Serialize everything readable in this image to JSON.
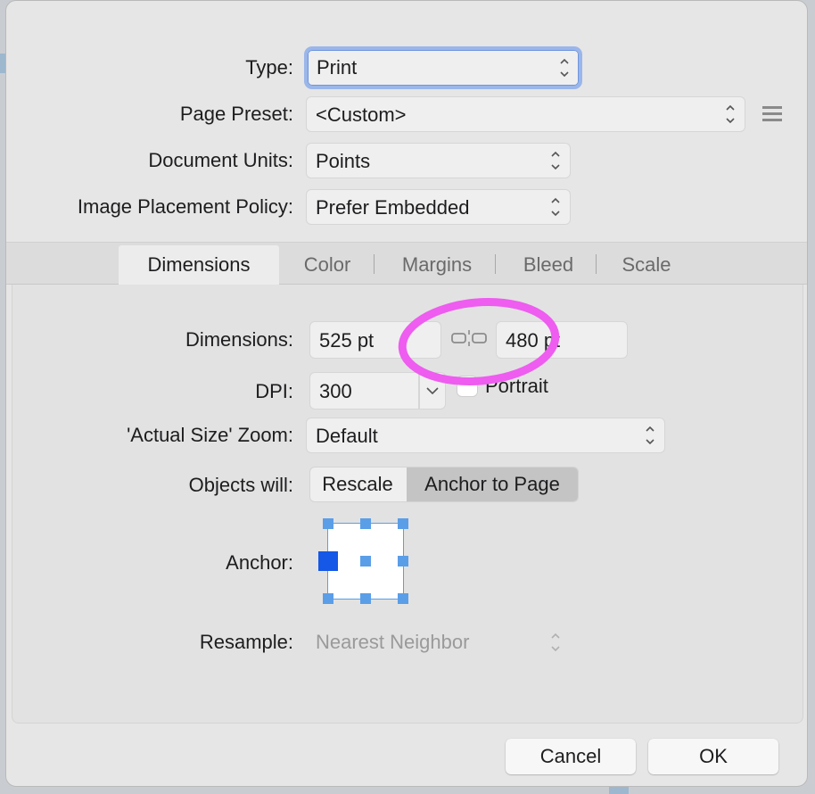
{
  "general": {
    "type_label": "Type:",
    "type_value": "Print",
    "page_preset_label": "Page Preset:",
    "page_preset_value": "<Custom>",
    "document_units_label": "Document Units:",
    "document_units_value": "Points",
    "image_policy_label": "Image Placement Policy:",
    "image_policy_value": "Prefer Embedded"
  },
  "tabs": [
    {
      "label": "Dimensions",
      "active": true
    },
    {
      "label": "Color",
      "active": false
    },
    {
      "label": "Margins",
      "active": false
    },
    {
      "label": "Bleed",
      "active": false
    },
    {
      "label": "Scale",
      "active": false
    }
  ],
  "dimensions": {
    "dimensions_label": "Dimensions:",
    "width_value": "525 pt",
    "height_value": "480 pt",
    "dpi_label": "DPI:",
    "dpi_value": "300",
    "portrait_label": "Portrait",
    "zoom_label": "'Actual Size' Zoom:",
    "zoom_value": "Default",
    "objects_label": "Objects will:",
    "rescale_label": "Rescale",
    "anchor_to_page_label": "Anchor to Page",
    "anchor_label": "Anchor:",
    "resample_label": "Resample:",
    "resample_value": "Nearest Neighbor"
  },
  "footer": {
    "cancel_label": "Cancel",
    "ok_label": "OK"
  },
  "colors": {
    "annotation_circle": "#ee5cf0",
    "anchor_selected": "#1557e6",
    "anchor_handle": "#5a9ee8",
    "focus_ring": "#9ab6ea"
  },
  "icons": [
    "chevron-updown-icon",
    "hamburger-menu-icon",
    "link-chain-icon",
    "chevron-down-icon"
  ]
}
